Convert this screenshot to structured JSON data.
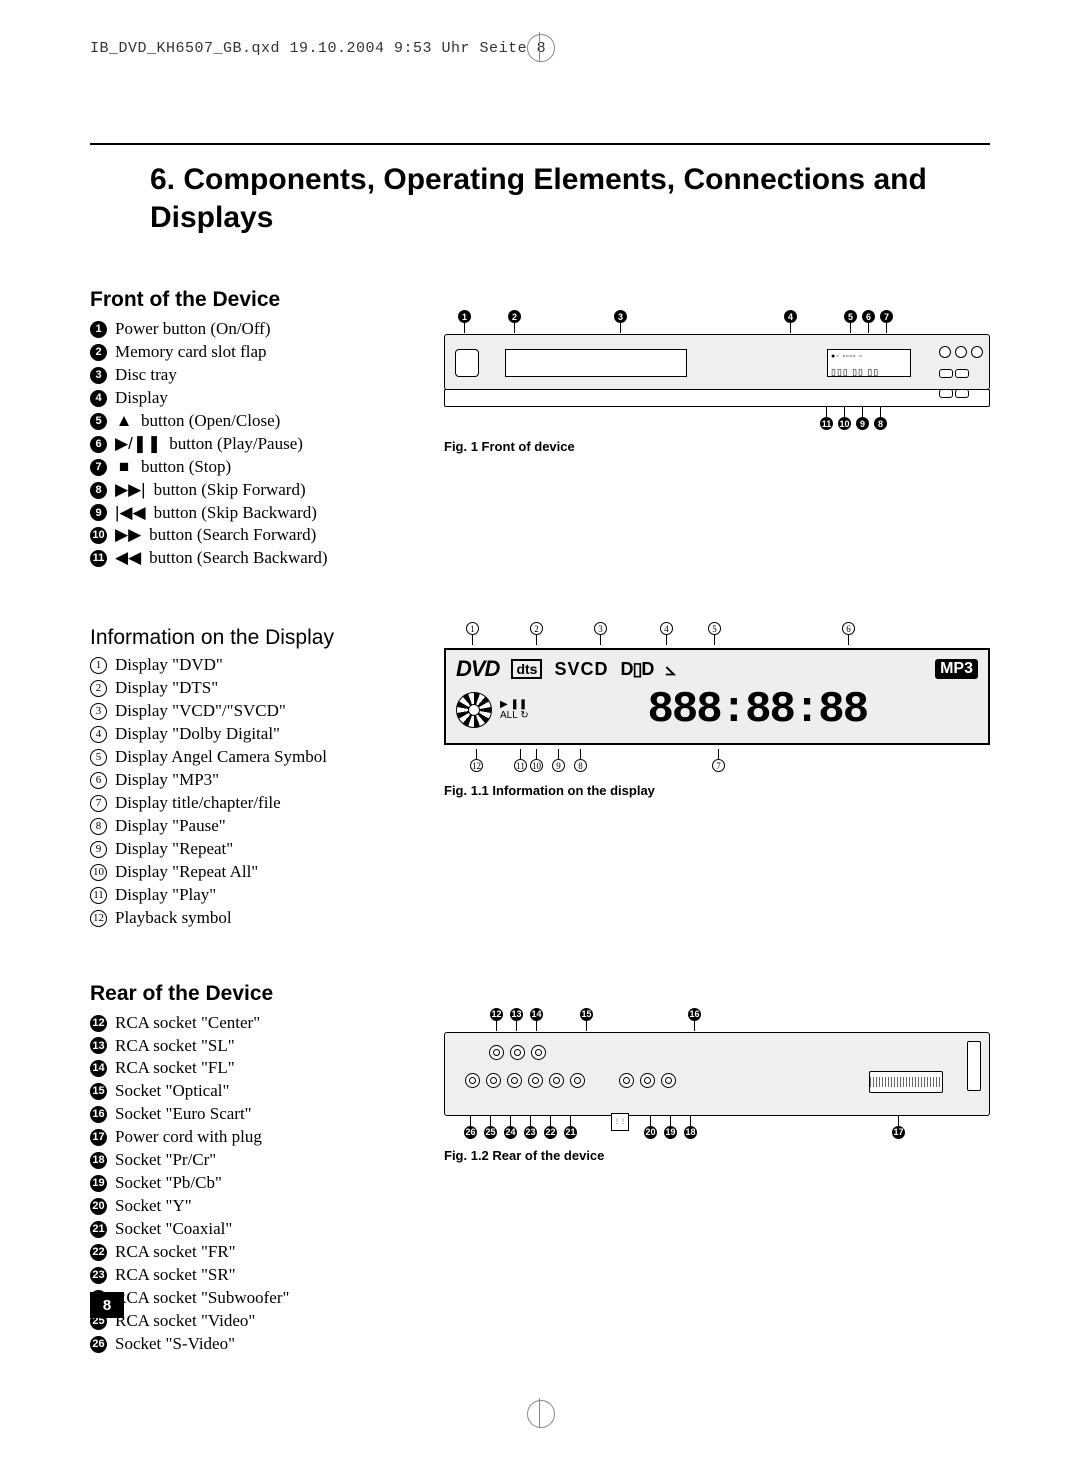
{
  "print_header": "IB_DVD_KH6507_GB.qxd  19.10.2004  9:53 Uhr  Seite 8",
  "section_number": "6.",
  "section_title": "Components, Operating Elements, Connections and Displays",
  "page_number": "8",
  "front": {
    "heading": "Front of the Device",
    "items": [
      {
        "n": "1",
        "sym": "",
        "text": "Power button (On/Off)"
      },
      {
        "n": "2",
        "sym": "",
        "text": "Memory card slot flap"
      },
      {
        "n": "3",
        "sym": "",
        "text": "Disc tray"
      },
      {
        "n": "4",
        "sym": "",
        "text": "Display"
      },
      {
        "n": "5",
        "sym": "▲",
        "text": " button (Open/Close)"
      },
      {
        "n": "6",
        "sym": "▶/❚❚",
        "text": "button (Play/Pause)"
      },
      {
        "n": "7",
        "sym": "■",
        "text": " button (Stop)"
      },
      {
        "n": "8",
        "sym": "▶▶|",
        "text": "button (Skip Forward)"
      },
      {
        "n": "9",
        "sym": "|◀◀",
        "text": "button (Skip Backward)"
      },
      {
        "n": "10",
        "sym": "▶▶",
        "text": "button (Search Forward)"
      },
      {
        "n": "11",
        "sym": "◀◀",
        "text": "button (Search Backward)"
      }
    ],
    "fig_caption": "Fig. 1 Front of device",
    "callouts_top": [
      "1",
      "2",
      "3",
      "4",
      "5",
      "6",
      "7"
    ],
    "callouts_bottom": [
      "11",
      "10",
      "9",
      "8"
    ]
  },
  "display": {
    "heading": "Information on the Display",
    "items": [
      {
        "n": "1",
        "text": "Display \"DVD\""
      },
      {
        "n": "2",
        "text": "Display \"DTS\""
      },
      {
        "n": "3",
        "text": "Display \"VCD\"/\"SVCD\""
      },
      {
        "n": "4",
        "text": "Display \"Dolby Digital\""
      },
      {
        "n": "5",
        "text": "Display Angel Camera Symbol"
      },
      {
        "n": "6",
        "text": "Display \"MP3\""
      },
      {
        "n": "7",
        "text": "Display title/chapter/file"
      },
      {
        "n": "8",
        "text": "Display \"Pause\""
      },
      {
        "n": "9",
        "text": "Display \"Repeat\""
      },
      {
        "n": "10",
        "text": "Display \"Repeat All\""
      },
      {
        "n": "11",
        "text": "Display \"Play\""
      },
      {
        "n": "12",
        "text": "Playback symbol"
      }
    ],
    "fig_caption": "Fig. 1.1 Information on the display",
    "panel": {
      "dvd": "DVD",
      "dts": "dts",
      "svcd": "SVCD",
      "dd": "D▯D",
      "angle": "⦣",
      "mp3": "MP3",
      "left_icons": "▶ ❚❚\nALL ↻",
      "segments": "888:88:88"
    },
    "callouts_top": [
      "1",
      "2",
      "3",
      "4",
      "5",
      "6"
    ],
    "callouts_bottom": [
      "12",
      "11",
      "10",
      "9",
      "8",
      "7"
    ]
  },
  "rear": {
    "heading": "Rear of the Device",
    "items": [
      {
        "n": "12",
        "text": "RCA socket \"Center\""
      },
      {
        "n": "13",
        "text": "RCA socket \"SL\""
      },
      {
        "n": "14",
        "text": "RCA socket \"FL\""
      },
      {
        "n": "15",
        "text": "Socket \"Optical\""
      },
      {
        "n": "16",
        "text": "Socket \"Euro Scart\""
      },
      {
        "n": "17",
        "text": "Power cord with plug"
      },
      {
        "n": "18",
        "text": "Socket \"Pr/Cr\""
      },
      {
        "n": "19",
        "text": "Socket \"Pb/Cb\""
      },
      {
        "n": "20",
        "text": "Socket \"Y\""
      },
      {
        "n": "21",
        "text": "Socket \"Coaxial\""
      },
      {
        "n": "22",
        "text": "RCA socket \"FR\""
      },
      {
        "n": "23",
        "text": "RCA socket \"SR\""
      },
      {
        "n": "24",
        "text": "RCA socket \"Subwoofer\""
      },
      {
        "n": "25",
        "text": "RCA socket \"Video\""
      },
      {
        "n": "26",
        "text": "Socket \"S-Video\""
      }
    ],
    "fig_caption": "Fig. 1.2 Rear of the device",
    "callouts_top": [
      "12",
      "13",
      "14",
      "15",
      "16"
    ],
    "callouts_bottom_left": [
      "26",
      "25",
      "24",
      "23",
      "22",
      "21"
    ],
    "callouts_bottom_mid": [
      "20",
      "19",
      "18"
    ],
    "callouts_bottom_right": [
      "17"
    ]
  }
}
